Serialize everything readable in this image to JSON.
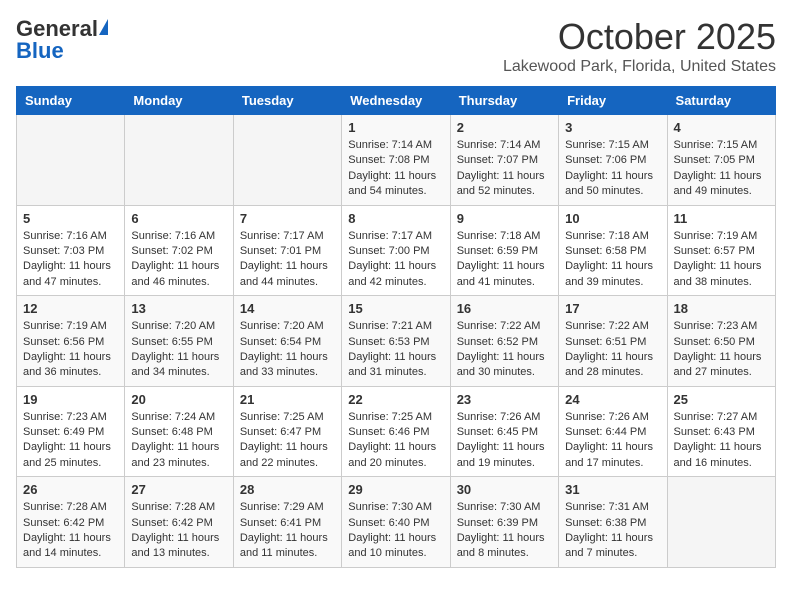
{
  "header": {
    "logo_general": "General",
    "logo_blue": "Blue",
    "month_title": "October 2025",
    "location": "Lakewood Park, Florida, United States"
  },
  "weekdays": [
    "Sunday",
    "Monday",
    "Tuesday",
    "Wednesday",
    "Thursday",
    "Friday",
    "Saturday"
  ],
  "weeks": [
    [
      {
        "day": "",
        "info": ""
      },
      {
        "day": "",
        "info": ""
      },
      {
        "day": "",
        "info": ""
      },
      {
        "day": "1",
        "info": "Sunrise: 7:14 AM\nSunset: 7:08 PM\nDaylight: 11 hours and 54 minutes."
      },
      {
        "day": "2",
        "info": "Sunrise: 7:14 AM\nSunset: 7:07 PM\nDaylight: 11 hours and 52 minutes."
      },
      {
        "day": "3",
        "info": "Sunrise: 7:15 AM\nSunset: 7:06 PM\nDaylight: 11 hours and 50 minutes."
      },
      {
        "day": "4",
        "info": "Sunrise: 7:15 AM\nSunset: 7:05 PM\nDaylight: 11 hours and 49 minutes."
      }
    ],
    [
      {
        "day": "5",
        "info": "Sunrise: 7:16 AM\nSunset: 7:03 PM\nDaylight: 11 hours and 47 minutes."
      },
      {
        "day": "6",
        "info": "Sunrise: 7:16 AM\nSunset: 7:02 PM\nDaylight: 11 hours and 46 minutes."
      },
      {
        "day": "7",
        "info": "Sunrise: 7:17 AM\nSunset: 7:01 PM\nDaylight: 11 hours and 44 minutes."
      },
      {
        "day": "8",
        "info": "Sunrise: 7:17 AM\nSunset: 7:00 PM\nDaylight: 11 hours and 42 minutes."
      },
      {
        "day": "9",
        "info": "Sunrise: 7:18 AM\nSunset: 6:59 PM\nDaylight: 11 hours and 41 minutes."
      },
      {
        "day": "10",
        "info": "Sunrise: 7:18 AM\nSunset: 6:58 PM\nDaylight: 11 hours and 39 minutes."
      },
      {
        "day": "11",
        "info": "Sunrise: 7:19 AM\nSunset: 6:57 PM\nDaylight: 11 hours and 38 minutes."
      }
    ],
    [
      {
        "day": "12",
        "info": "Sunrise: 7:19 AM\nSunset: 6:56 PM\nDaylight: 11 hours and 36 minutes."
      },
      {
        "day": "13",
        "info": "Sunrise: 7:20 AM\nSunset: 6:55 PM\nDaylight: 11 hours and 34 minutes."
      },
      {
        "day": "14",
        "info": "Sunrise: 7:20 AM\nSunset: 6:54 PM\nDaylight: 11 hours and 33 minutes."
      },
      {
        "day": "15",
        "info": "Sunrise: 7:21 AM\nSunset: 6:53 PM\nDaylight: 11 hours and 31 minutes."
      },
      {
        "day": "16",
        "info": "Sunrise: 7:22 AM\nSunset: 6:52 PM\nDaylight: 11 hours and 30 minutes."
      },
      {
        "day": "17",
        "info": "Sunrise: 7:22 AM\nSunset: 6:51 PM\nDaylight: 11 hours and 28 minutes."
      },
      {
        "day": "18",
        "info": "Sunrise: 7:23 AM\nSunset: 6:50 PM\nDaylight: 11 hours and 27 minutes."
      }
    ],
    [
      {
        "day": "19",
        "info": "Sunrise: 7:23 AM\nSunset: 6:49 PM\nDaylight: 11 hours and 25 minutes."
      },
      {
        "day": "20",
        "info": "Sunrise: 7:24 AM\nSunset: 6:48 PM\nDaylight: 11 hours and 23 minutes."
      },
      {
        "day": "21",
        "info": "Sunrise: 7:25 AM\nSunset: 6:47 PM\nDaylight: 11 hours and 22 minutes."
      },
      {
        "day": "22",
        "info": "Sunrise: 7:25 AM\nSunset: 6:46 PM\nDaylight: 11 hours and 20 minutes."
      },
      {
        "day": "23",
        "info": "Sunrise: 7:26 AM\nSunset: 6:45 PM\nDaylight: 11 hours and 19 minutes."
      },
      {
        "day": "24",
        "info": "Sunrise: 7:26 AM\nSunset: 6:44 PM\nDaylight: 11 hours and 17 minutes."
      },
      {
        "day": "25",
        "info": "Sunrise: 7:27 AM\nSunset: 6:43 PM\nDaylight: 11 hours and 16 minutes."
      }
    ],
    [
      {
        "day": "26",
        "info": "Sunrise: 7:28 AM\nSunset: 6:42 PM\nDaylight: 11 hours and 14 minutes."
      },
      {
        "day": "27",
        "info": "Sunrise: 7:28 AM\nSunset: 6:42 PM\nDaylight: 11 hours and 13 minutes."
      },
      {
        "day": "28",
        "info": "Sunrise: 7:29 AM\nSunset: 6:41 PM\nDaylight: 11 hours and 11 minutes."
      },
      {
        "day": "29",
        "info": "Sunrise: 7:30 AM\nSunset: 6:40 PM\nDaylight: 11 hours and 10 minutes."
      },
      {
        "day": "30",
        "info": "Sunrise: 7:30 AM\nSunset: 6:39 PM\nDaylight: 11 hours and 8 minutes."
      },
      {
        "day": "31",
        "info": "Sunrise: 7:31 AM\nSunset: 6:38 PM\nDaylight: 11 hours and 7 minutes."
      },
      {
        "day": "",
        "info": ""
      }
    ]
  ]
}
